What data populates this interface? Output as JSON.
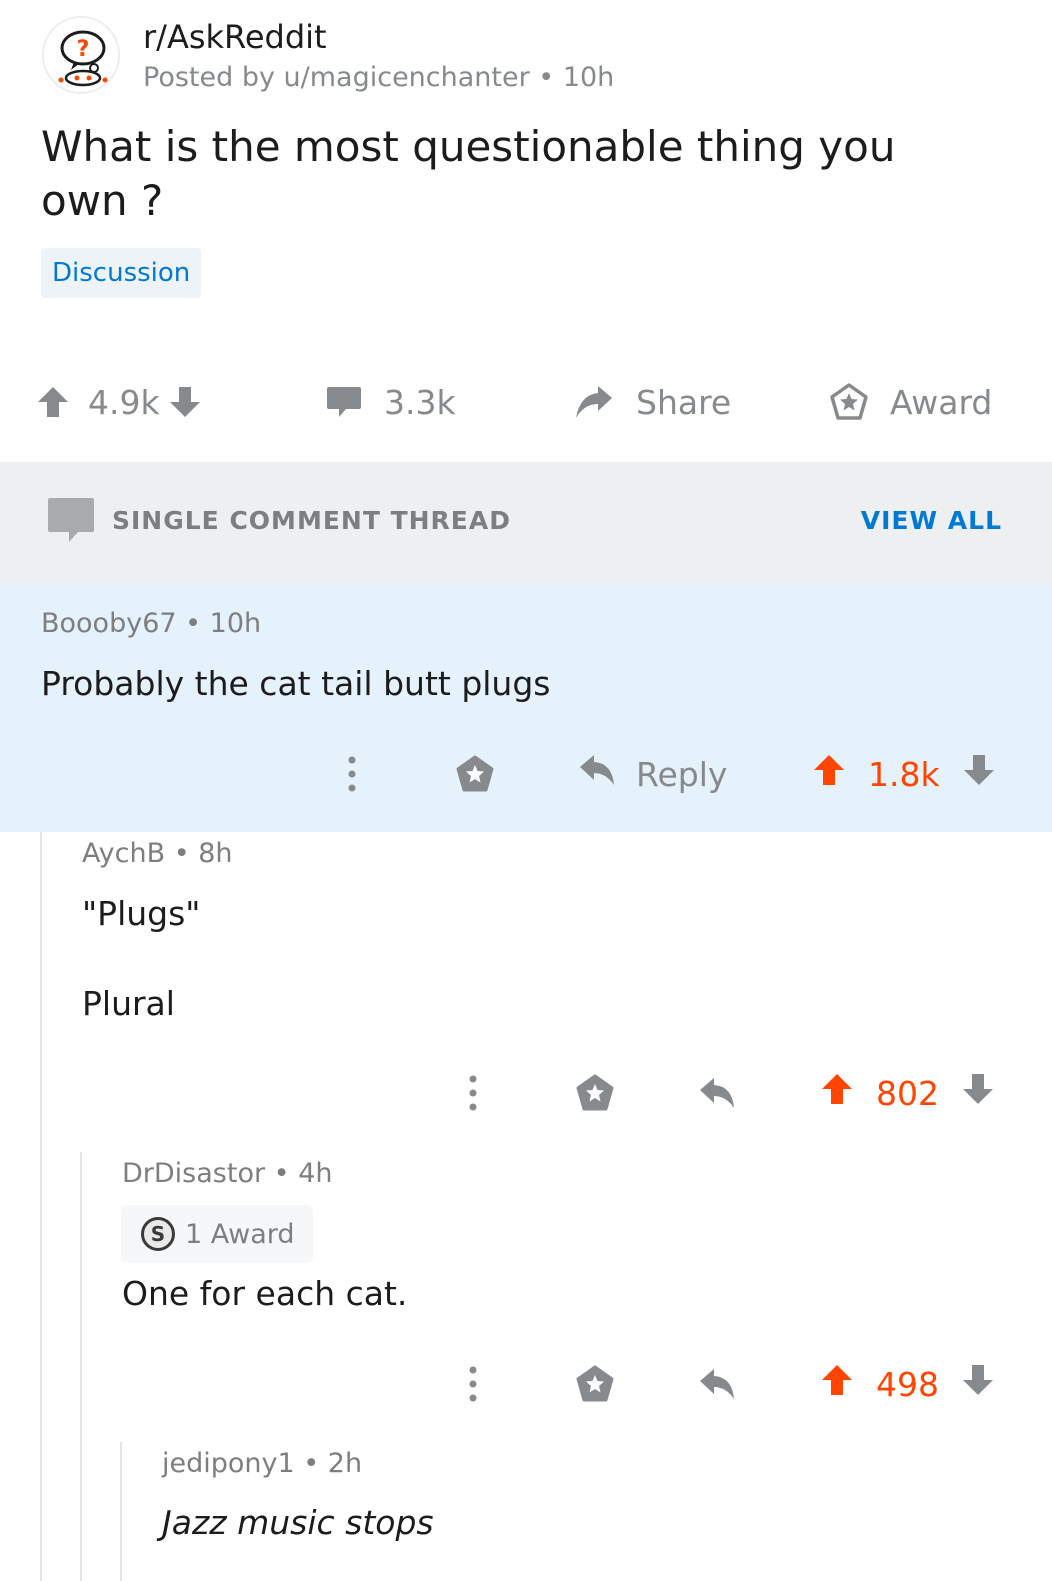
{
  "post": {
    "subreddit": "r/AskReddit",
    "posted_by": "Posted by u/magicenchanter",
    "age": "10h",
    "title": "What is the most questionable thing you own ?",
    "flair": "Discussion",
    "score": "4.9k",
    "comments": "3.3k",
    "share_label": "Share",
    "award_label": "Award"
  },
  "thread_bar": {
    "label": "SINGLE COMMENT THREAD",
    "view_all": "VIEW ALL"
  },
  "comments": [
    {
      "author": "Boooby67",
      "age": "10h",
      "body": "Probably the cat tail butt plugs",
      "reply_label": "Reply",
      "score": "1.8k"
    },
    {
      "author": "AychB",
      "age": "8h",
      "body_lines": [
        "\"Plugs\"",
        "Plural"
      ],
      "score": "802"
    },
    {
      "author": "DrDisastor",
      "age": "4h",
      "award": "1 Award",
      "body": "One for each cat.",
      "score": "498"
    },
    {
      "author": "jedipony1",
      "age": "2h",
      "body": "Jazz music stops"
    }
  ],
  "colors": {
    "upvoted": "#ff4500",
    "link_blue": "#0079d3",
    "highlight_bg": "#e6f2fb",
    "meta_gray": "#878a8c"
  },
  "icons": {
    "subreddit": "askreddit-snoo-icon",
    "upvote": "arrow-up-icon",
    "downvote": "arrow-down-icon",
    "comment": "comment-bubble-icon",
    "share": "share-arrow-icon",
    "award": "award-star-icon",
    "reply": "reply-arrow-icon",
    "more": "more-vertical-icon"
  }
}
